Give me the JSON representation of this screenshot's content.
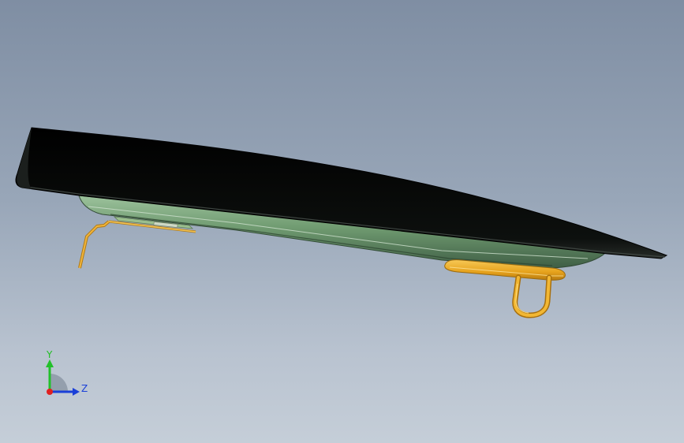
{
  "viewport": {
    "background_top": "#7f8ea3",
    "background_bottom": "#c5ced8"
  },
  "model": {
    "parts": [
      {
        "name": "top-cover",
        "color": "#0a0c0b"
      },
      {
        "name": "hull-body",
        "color": "#6f9a70"
      },
      {
        "name": "front-wire-bracket",
        "color": "#e0a020"
      },
      {
        "name": "rear-mount-pad",
        "color": "#e9a81e"
      },
      {
        "name": "rear-u-handle",
        "color": "#e9a81e"
      }
    ]
  },
  "triad": {
    "y_label": "Y",
    "z_label": "Z",
    "y_color": "#22c02a",
    "z_color": "#1a3fd8",
    "x_color": "#e02020",
    "label_y_color": "#1fbf22",
    "label_z_color": "#1a3fd8"
  }
}
